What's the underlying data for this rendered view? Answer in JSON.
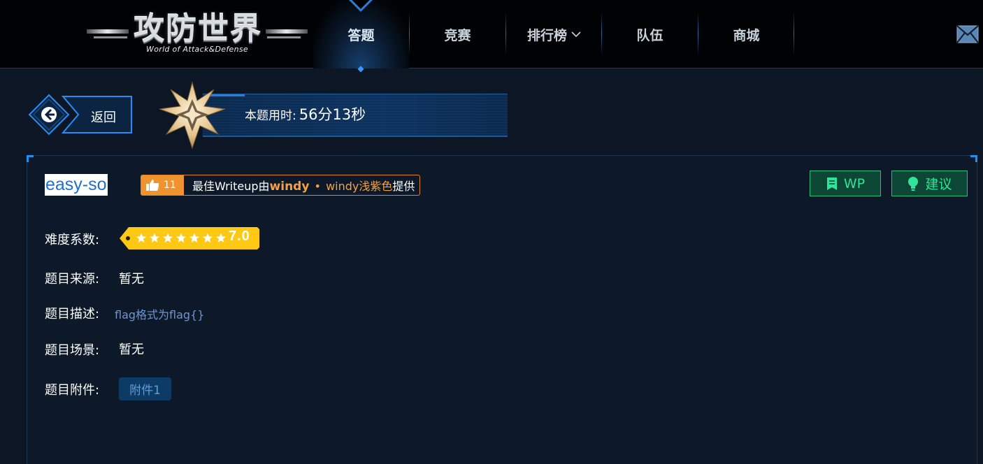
{
  "header": {
    "logo_title": "攻防世界",
    "logo_subtitle": "World of Attack&Defense",
    "nav": [
      {
        "label": "答题",
        "active": true
      },
      {
        "label": "竞赛",
        "active": false
      },
      {
        "label": "排行榜",
        "active": false,
        "has_dropdown": true
      },
      {
        "label": "队伍",
        "active": false
      },
      {
        "label": "商城",
        "active": false
      }
    ],
    "dropdown_icon": "chevron-down-icon",
    "mail_icon": "mail-icon"
  },
  "info": {
    "back_label": "返回",
    "time_label": "本题用时:",
    "time_value": "56分13秒"
  },
  "problem": {
    "title": "easy-so",
    "writeup": {
      "likes": "11",
      "prefix": "最佳Writeup由",
      "author": "windy",
      "separator": "•",
      "team": "windy浅紫色",
      "suffix": "提供"
    },
    "buttons": {
      "wp": "WP",
      "suggest": "建议"
    },
    "difficulty_label": "难度系数:",
    "difficulty_stars": 7,
    "difficulty_value": "7.0",
    "source_label": "题目来源:",
    "source_value": "暂无",
    "desc_label": "题目描述:",
    "desc_value": "flag格式为flag{}",
    "scene_label": "题目场景:",
    "scene_value": "暂无",
    "attach_label": "题目附件:",
    "attach_button": "附件1"
  },
  "colors": {
    "background": "#0c1624",
    "accent_blue": "#1f8ff0",
    "writeup_orange": "#f0932f",
    "button_green": "#2fe49a",
    "difficulty_yellow": "#ffc814"
  }
}
